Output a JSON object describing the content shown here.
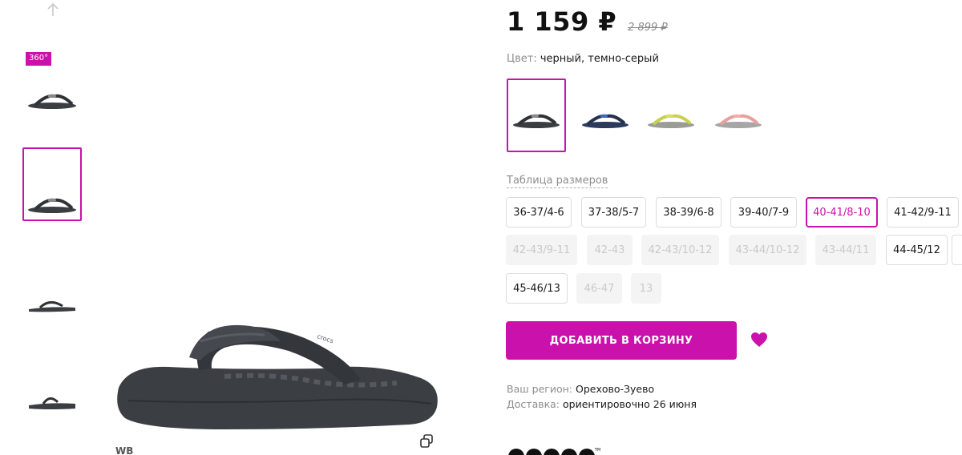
{
  "gallery": {
    "badge_360": "360°",
    "watermark": "WB"
  },
  "product": {
    "price": "1 159 ₽",
    "old_price": "2 899 ₽",
    "color_label": "Цвет:",
    "color_value": "черный, темно-серый",
    "size_table_link": "Таблица размеров",
    "sizes": [
      {
        "label": "36-37/4-6",
        "available": true,
        "selected": false
      },
      {
        "label": "37-38/5-7",
        "available": true,
        "selected": false
      },
      {
        "label": "38-39/6-8",
        "available": true,
        "selected": false
      },
      {
        "label": "39-40/7-9",
        "available": true,
        "selected": false
      },
      {
        "label": "40-41/8-10",
        "available": true,
        "selected": true
      },
      {
        "label": "41-42/9-11",
        "available": true,
        "selected": false
      },
      {
        "label": "42-43/9-11",
        "available": false,
        "selected": false
      },
      {
        "label": "42-43",
        "available": false,
        "selected": false
      },
      {
        "label": "42-43/10-12",
        "available": false,
        "selected": false
      },
      {
        "label": "43-44/10-12",
        "available": false,
        "selected": false
      },
      {
        "label": "43-44/11",
        "available": false,
        "selected": false
      },
      {
        "label": "44-45/12",
        "available": true,
        "selected": false
      },
      {
        "label": "45-46/13",
        "available": true,
        "selected": false
      },
      {
        "label": "46-47",
        "available": false,
        "selected": false
      },
      {
        "label": "13",
        "available": false,
        "selected": false
      }
    ],
    "add_to_cart_label": "ДОБАВИТЬ В КОРЗИНУ",
    "region_label": "Ваш регион:",
    "region_value": "Орехово-Зуево",
    "delivery_label": "Доставка:",
    "delivery_value": "ориентировочно 26 июня",
    "brand": "crocs"
  },
  "colors": {
    "accent": "#cb11ab",
    "swatches": [
      "#3a3d42",
      "#2b3a5c",
      "#c9d14a",
      "#e8a09a"
    ]
  }
}
